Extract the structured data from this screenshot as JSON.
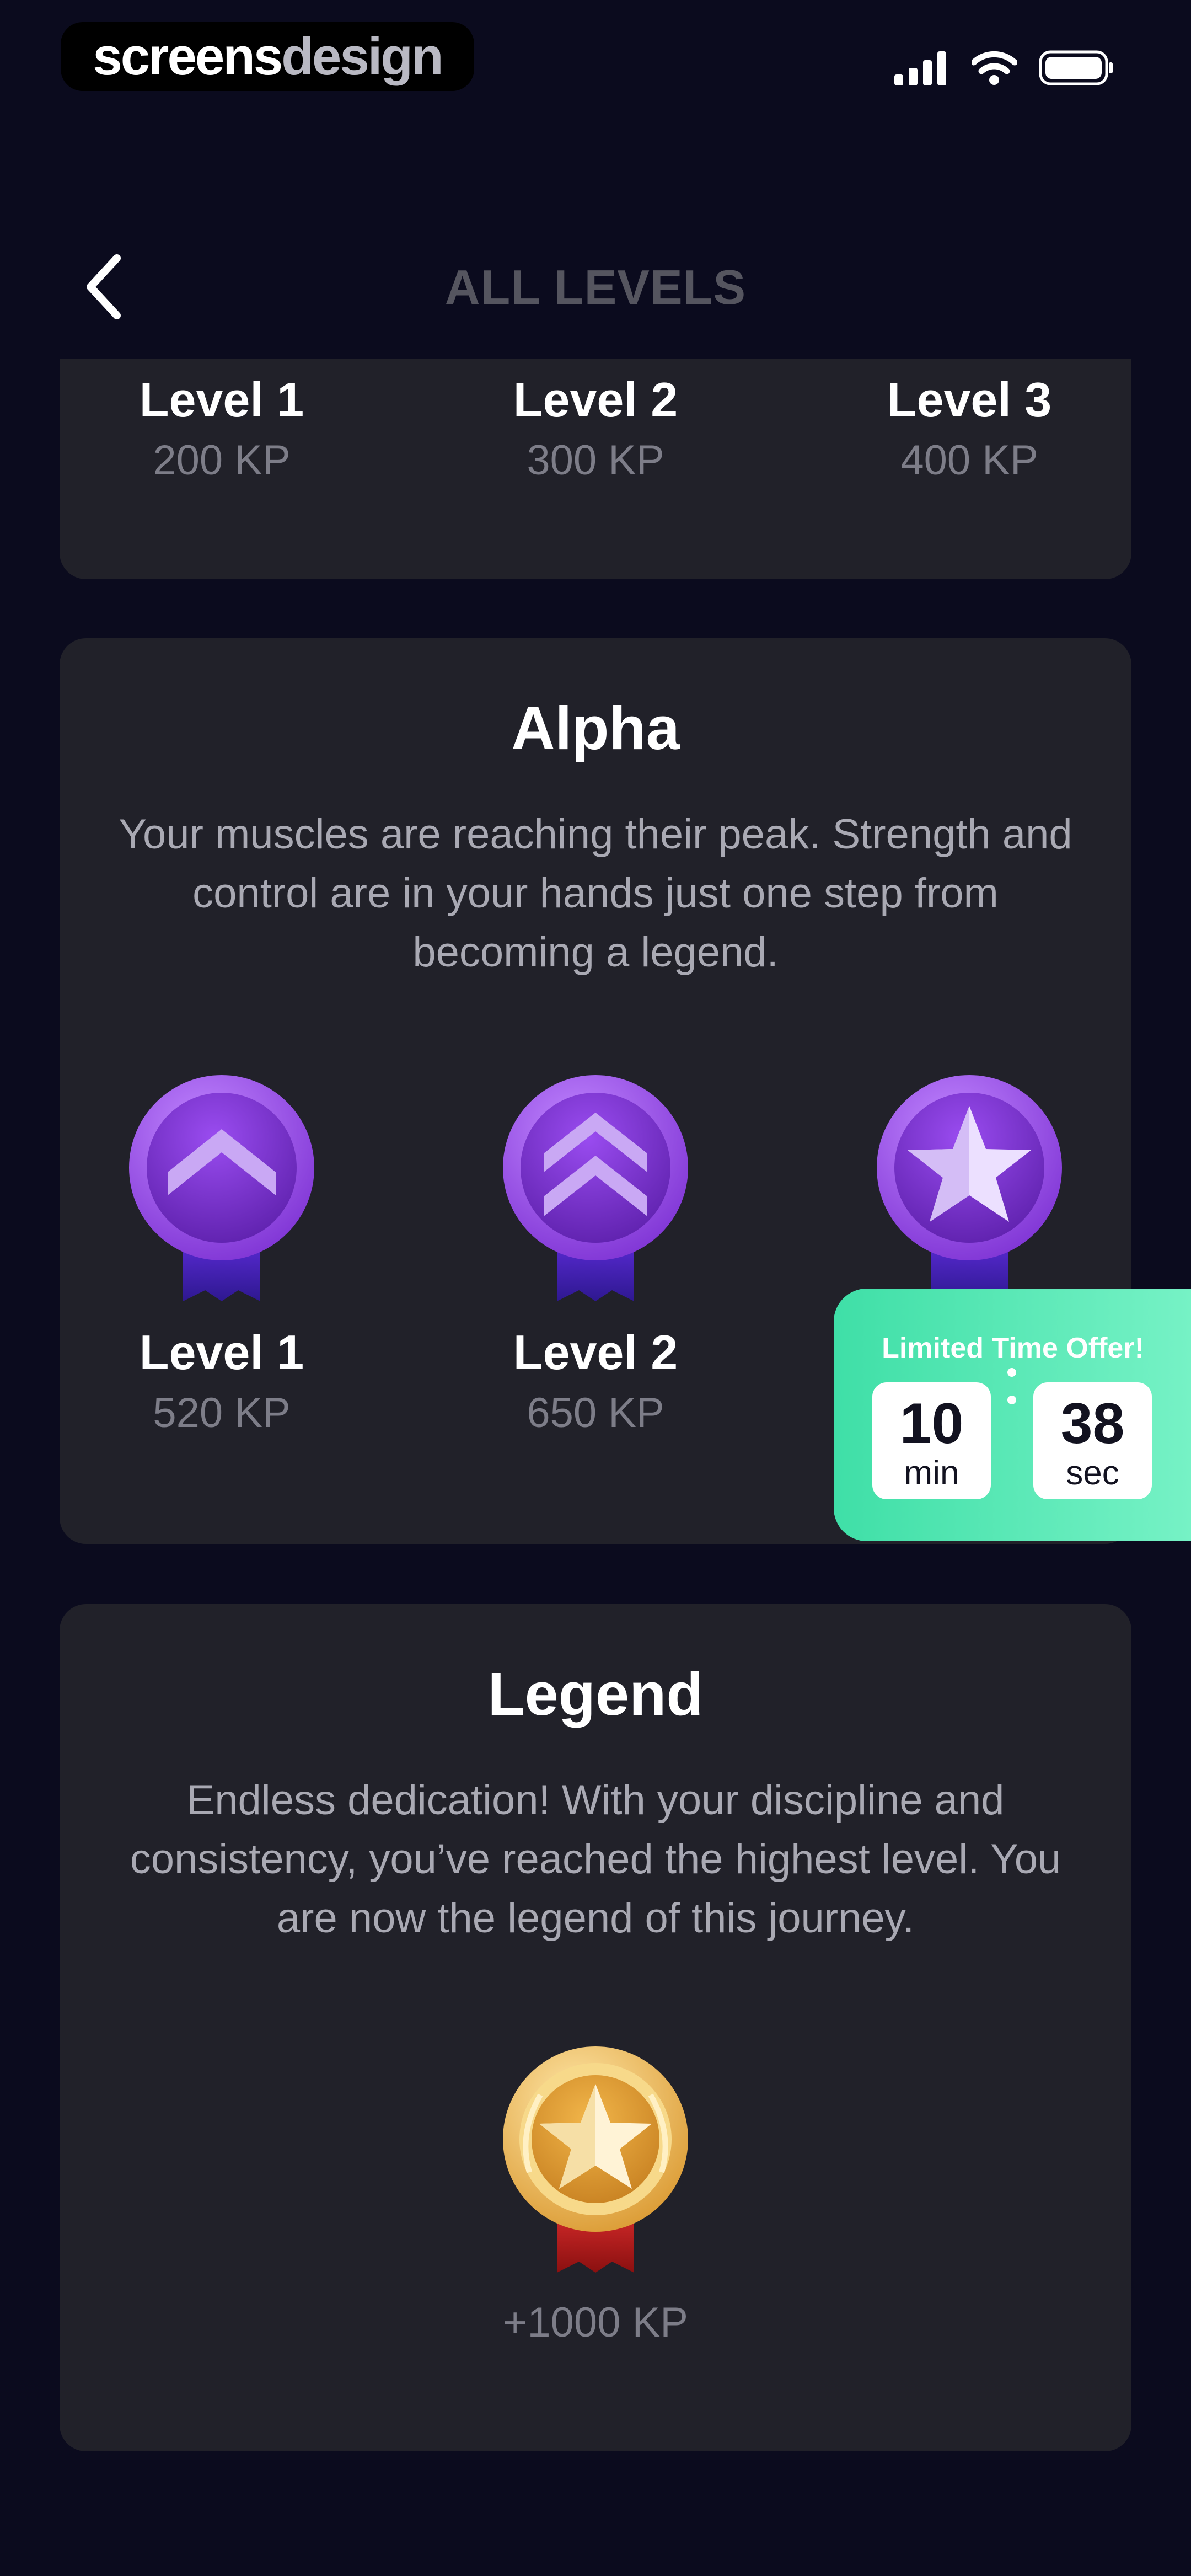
{
  "status_bar": {
    "brand_part1": "screens",
    "brand_part2": "design"
  },
  "header": {
    "title": "ALL LEVELS"
  },
  "top_card": {
    "levels": [
      {
        "name": "Level 1",
        "kp": "200 KP"
      },
      {
        "name": "Level 2",
        "kp": "300 KP"
      },
      {
        "name": "Level 3",
        "kp": "400 KP"
      }
    ]
  },
  "alpha_card": {
    "title": "Alpha",
    "description": "Your muscles are reaching their peak. Strength and control are in your hands just one step from becoming a legend.",
    "levels": [
      {
        "name": "Level 1",
        "kp": "520 KP",
        "icon": "chevron-up-medal-icon"
      },
      {
        "name": "Level 2",
        "kp": "650 KP",
        "icon": "double-chevron-medal-icon"
      },
      {
        "icon": "star-medal-icon"
      }
    ]
  },
  "legend_card": {
    "title": "Legend",
    "description": "Endless dedication! With your discipline and consistency, you’ve reached the highest level. You are now the legend of this journey.",
    "reward": "+1000 KP",
    "icon": "gold-laurel-star-medal-icon"
  },
  "offer": {
    "title": "Limited Time Offer!",
    "minutes": "10",
    "minutes_label": "min",
    "seconds": "38",
    "seconds_label": "sec"
  },
  "colors": {
    "background": "#0b0b1e",
    "card": "#212129",
    "purple_medal": "#8a3fdb",
    "gold_medal": "#e3a53a",
    "offer_green": "#4be3ad"
  }
}
